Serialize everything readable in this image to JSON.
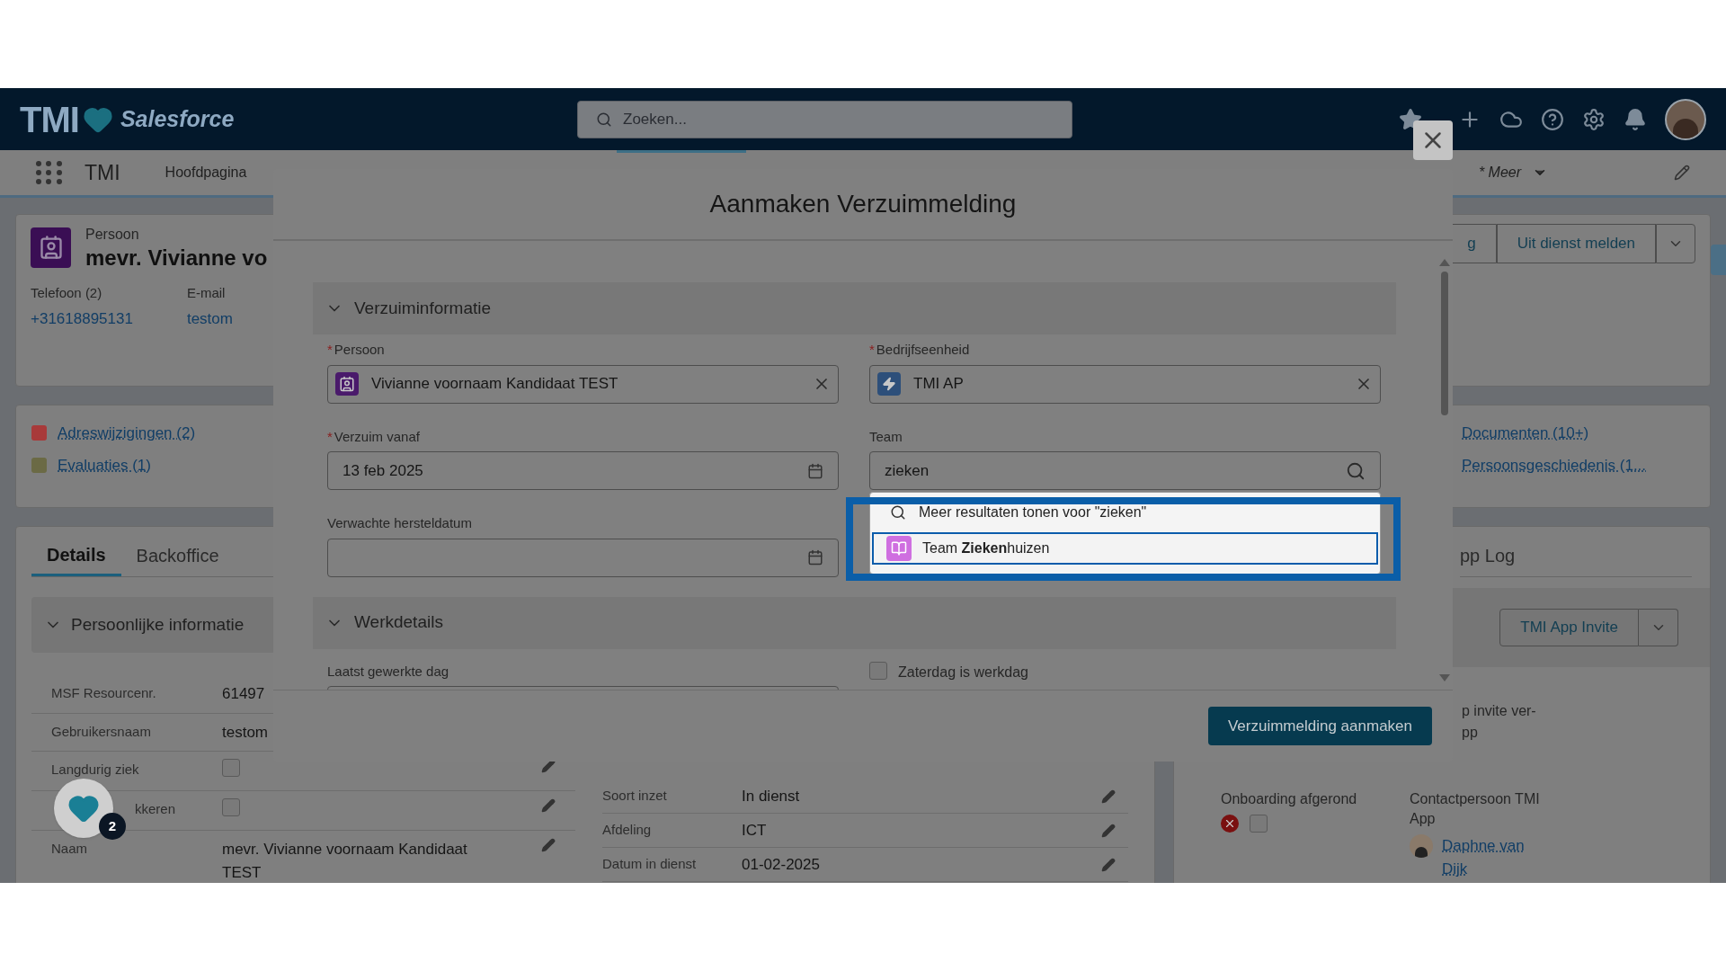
{
  "header": {
    "logo_text": "TMI",
    "logo_subtext": "Salesforce",
    "search": {
      "placeholder": "Zoeken..."
    }
  },
  "nav": {
    "app_name": "TMI",
    "items": [
      {
        "label": "Hoofdpagina"
      }
    ],
    "more": "* Meer"
  },
  "record": {
    "object_label": "Persoon",
    "name": "mevr. Vivianne vo",
    "phone_label": "Telefoon (2)",
    "phone": "+31618895131",
    "email_label": "E-mail",
    "email": "testom",
    "buttons": [
      "g",
      "Uit dienst melden"
    ]
  },
  "related_left": [
    {
      "label": "Adreswijzigingen (2)",
      "color": "#a83a3a"
    },
    {
      "label": "Evaluaties (1)",
      "color": "#6b6a45"
    }
  ],
  "related_right": [
    {
      "label": "Documenten (10+)"
    },
    {
      "label": "Persoonsgeschiedenis (1..."
    }
  ],
  "tabs": [
    {
      "label": "Details",
      "selected": true
    },
    {
      "label": "Backoffice",
      "selected": false
    }
  ],
  "personal_section": {
    "title": "Persoonlijke informatie",
    "expanded": true
  },
  "personal_fields": [
    {
      "kind": "text",
      "label": "MSF Resourcenr.",
      "value": "61497"
    },
    {
      "kind": "text",
      "label": "Gebruikersnaam",
      "value": "testom"
    },
    {
      "kind": "checkbox",
      "label": "Langdurig ziek",
      "checked": false
    },
    {
      "kind": "checkbox",
      "label": "kkeren",
      "checked": false
    },
    {
      "kind": "text",
      "label": "Naam",
      "value": "mevr. Vivianne voornaam Kandidaat TEST"
    }
  ],
  "work_fields": [
    {
      "label": "Soort inzet",
      "value": "In dienst"
    },
    {
      "label": "Afdeling",
      "value": "ICT"
    },
    {
      "label": "Datum in dienst",
      "value": "01-02-2025"
    }
  ],
  "app_panel": {
    "tab": "pp Log",
    "button": "TMI App Invite",
    "note_lines": [
      "p invite ver-",
      "pp"
    ],
    "onboarding_label": "Onboarding afgerond",
    "onboarding_checked": false,
    "contact_label": "Contactpersoon TMI App",
    "contact_name": "Daphne van Dijk"
  },
  "helper_badge": "2",
  "modal": {
    "title": "Aanmaken Verzuimmelding",
    "required_mark": "*",
    "section1": {
      "title": "Verzuiminformatie",
      "expanded": true
    },
    "left_fields": [
      {
        "kind": "lookup",
        "label": "Persoon",
        "required": true,
        "value": "Vivianne voornaam Kandidaat TEST"
      },
      {
        "kind": "date",
        "label": "Verzuim vanaf",
        "required": true,
        "value": "13 feb 2025"
      },
      {
        "kind": "date",
        "label": "Verwachte hersteldatum",
        "required": false
      }
    ],
    "right_fields": [
      {
        "kind": "lookup",
        "label": "Bedrijfseenheid",
        "required": true,
        "value": "TMI AP"
      },
      {
        "kind": "search",
        "label": "Team",
        "required": false,
        "value": "zieken"
      }
    ],
    "dropdown": {
      "more": "Meer resultaten tonen voor \"zieken\"",
      "options": [
        {
          "text": "Team **Zieken**huizen",
          "selected": true
        }
      ]
    },
    "section2": {
      "title": "Werkdetails",
      "expanded": true
    },
    "work_left": {
      "label": "Laatst gewerkte dag"
    },
    "work_right": {
      "label": "Zaterdag is werkdag",
      "checked": false
    },
    "submit": "Verzuimmelding aanmaken"
  }
}
